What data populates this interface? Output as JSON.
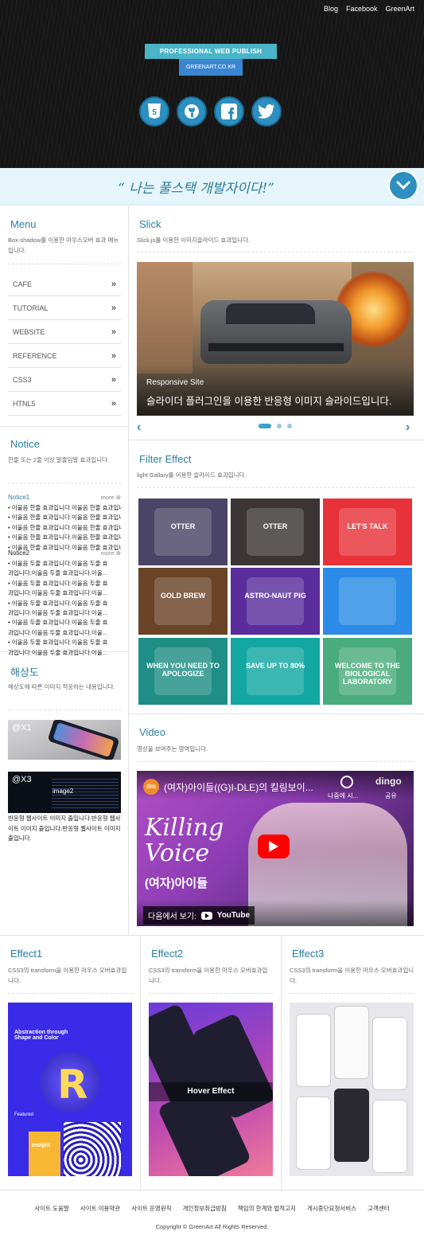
{
  "header": {
    "nav": [
      "Blog",
      "Facebook",
      "GreenArt"
    ],
    "logo_top": "PROFESSIONAL WEB PUBLISH",
    "logo_bottom": "GREENART.CO.KR",
    "social_icons": [
      "html5-icon",
      "github-icon",
      "facebook-icon",
      "twitter-icon"
    ]
  },
  "banner": {
    "slogan": "“ 나는 풀스택 개발자이다!”"
  },
  "menu": {
    "title": "Menu",
    "desc": "Box-shadow를 이용한 마우스오버 효과 메뉴입니다.",
    "items": [
      "CAFE",
      "TUTORIAL",
      "WEBSITE",
      "REFERENCE",
      "CSS3",
      "HTNL5"
    ]
  },
  "notice": {
    "title": "Notice",
    "desc": "한줄 또는 2줄 이상 말줄임말 효과입니다.",
    "more": "more",
    "n1_label": "Notice1",
    "n1_items": [
      "이울음 한줄 효과입니다.이울음 한줄 효과입니다.",
      "이울음 한줄 효과입니다.이울음 한줄 효과입니다.",
      "이울음 한줄 효과입니다.이울음 한줄 효과입니다.",
      "이울음 한줄 효과입니다.이울음 한줄 효과입니다.",
      "이울음 한줄 효과입니다.이울음 한줄 효과입니다."
    ],
    "n2_label": "Notice2",
    "n2_lines": [
      "이울음 두줄 효과입니다.이울음 두줄 효",
      "과입니다.이울음 두줄 효과입니다.이울...",
      "이울음 두줄 효과입니다.이울음 두줄 효",
      "과입니다.이울음 두줄 효과입니다.이울...",
      "이울음 두줄 효과입니다.이울음 두줄 효",
      "과입니다.이울음 두줄 효과입니다.이울...",
      "이울음 두줄 효과입니다.이울음 두줄 효",
      "과입니다.이울음 두줄 효과입니다.이울...",
      "이울음 두줄 효과입니다.이울음 두줄 효",
      "과입니다.이울음 두줄 효과입니다.이울..."
    ]
  },
  "resolution": {
    "title": "해상도",
    "desc": "해상도에 따른 이미지 적응하는 내용입니다.",
    "img1_label": "@X1",
    "img2_label": "@X3",
    "img2_caption": "image2",
    "text": "반응형 웹사이트 이미지 출입니다.반응형 웹사이트 이미지 출입니다.반응형 웹사이트 이미지 출입니다."
  },
  "slick": {
    "title": "Slick",
    "desc": "Slick.js를 이용한 이미지슬라이드 효과입니다.",
    "caption_small": "Responsive Site",
    "caption_big": "슬라이더 플러그인을 이용한 반응형 이미지 슬라이드입니다."
  },
  "filter": {
    "title": "Filter Effect",
    "desc": "light Gallary를 이용한 슬라이드 효과입니다.",
    "thumbs": [
      {
        "text": "OTTER",
        "bg": "#4a4466"
      },
      {
        "text": "OTTER",
        "bg": "#3b3535"
      },
      {
        "text": "LET'S TALK",
        "bg": "#e8323a"
      },
      {
        "text": "GOLD BREW",
        "bg": "#6b4326"
      },
      {
        "text": "ASTRO-NAUT PIG",
        "bg": "#5a2c9c"
      },
      {
        "text": "",
        "bg": "#2b8be6"
      },
      {
        "text": "WHEN YOU NEED TO APOLOGIZE",
        "bg": "#1f8e86"
      },
      {
        "text": "SAVE UP TO 80%",
        "bg": "#12a7a0"
      },
      {
        "text": "WELCOME TO THE BIOLOGICAL LABORATORY",
        "bg": "#4aab7c"
      }
    ]
  },
  "video": {
    "title": "Video",
    "desc": "영상을 보여주는 영역입니다.",
    "video_title": "(여자)아이들((G)I-DLE)의 킬링보이...",
    "watch_later": "나중에 시...",
    "share": "공유",
    "big_text": "Killing Voice",
    "sub_text": "(여자)아이들",
    "watch_on": "다음에서 보기:",
    "youtube": "YouTube",
    "channel": "dm",
    "brand": "dingo"
  },
  "effects": {
    "desc": "CSS3의 transform을 이용한 마우스 오버효과입니다.",
    "items": [
      {
        "title": "Effect1",
        "img_text": "Abstraction through Shape and Color",
        "sub": "Featured",
        "sub2": "Insight"
      },
      {
        "title": "Effect2",
        "img_text": "Hover Effect",
        "sub": "",
        "sub2": ""
      },
      {
        "title": "Effect3",
        "img_text": "",
        "sub": "",
        "sub2": ""
      }
    ]
  },
  "footer": {
    "links": [
      "사이트 도움말",
      "사이트 이용약관",
      "사이트 운영원칙",
      "개인정보취급방침",
      "책임의 한계와 법적고지",
      "게시중단요청서비스",
      "고객센터"
    ],
    "copyright": "Copyright © GreenArt All Rights Reserved."
  },
  "colors": {
    "accent": "#2b7ea3",
    "header_bg": "#151515",
    "banner_bg": "#e6f4fb"
  }
}
